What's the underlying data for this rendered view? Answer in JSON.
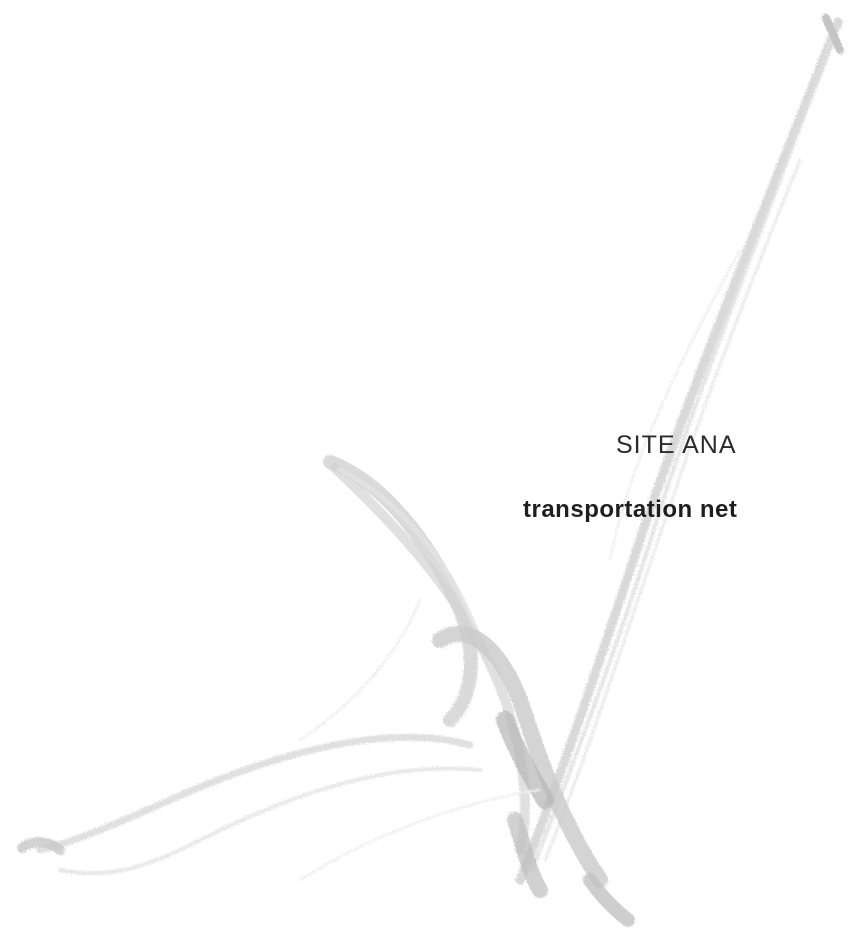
{
  "heading": {
    "label": "SITE ANA",
    "subtitle": "transportation net"
  },
  "decoration": {
    "brush_color": "#b5b5b5",
    "background_color": "#ffffff"
  }
}
